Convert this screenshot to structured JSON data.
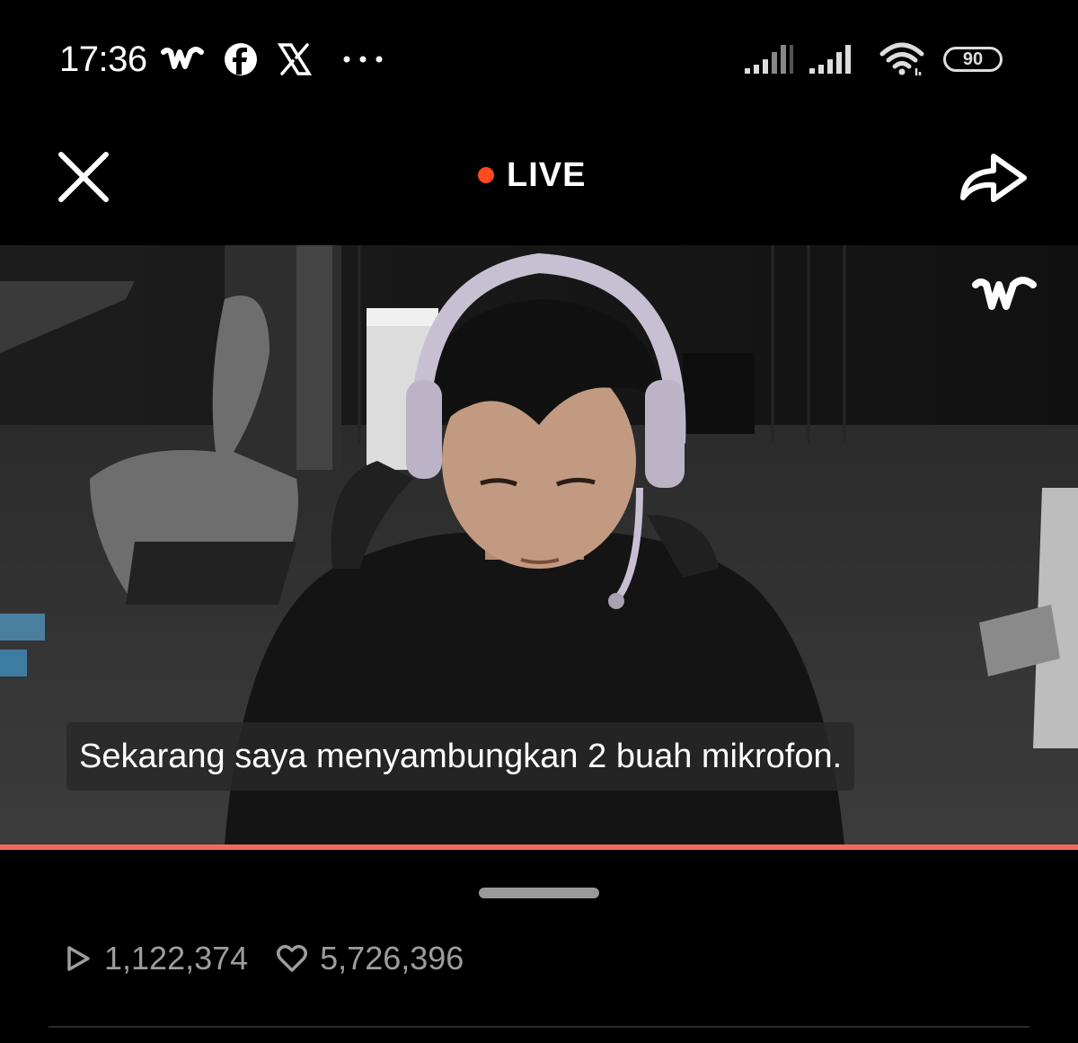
{
  "status_bar": {
    "time": "17:36",
    "notification_icons": [
      "weverse-icon",
      "facebook-icon",
      "x-icon",
      "more-dots-icon"
    ],
    "battery": "90"
  },
  "header": {
    "live_label": "LIVE",
    "live_dot_color": "#ff4a1c"
  },
  "video": {
    "subtitle": "Sekarang saya menyambungkan 2 buah mikrofon.",
    "watermark_icon": "weverse-logo",
    "progress_color": "#f26a5b"
  },
  "stats": {
    "plays": "1,122,374",
    "likes": "5,726,396"
  }
}
